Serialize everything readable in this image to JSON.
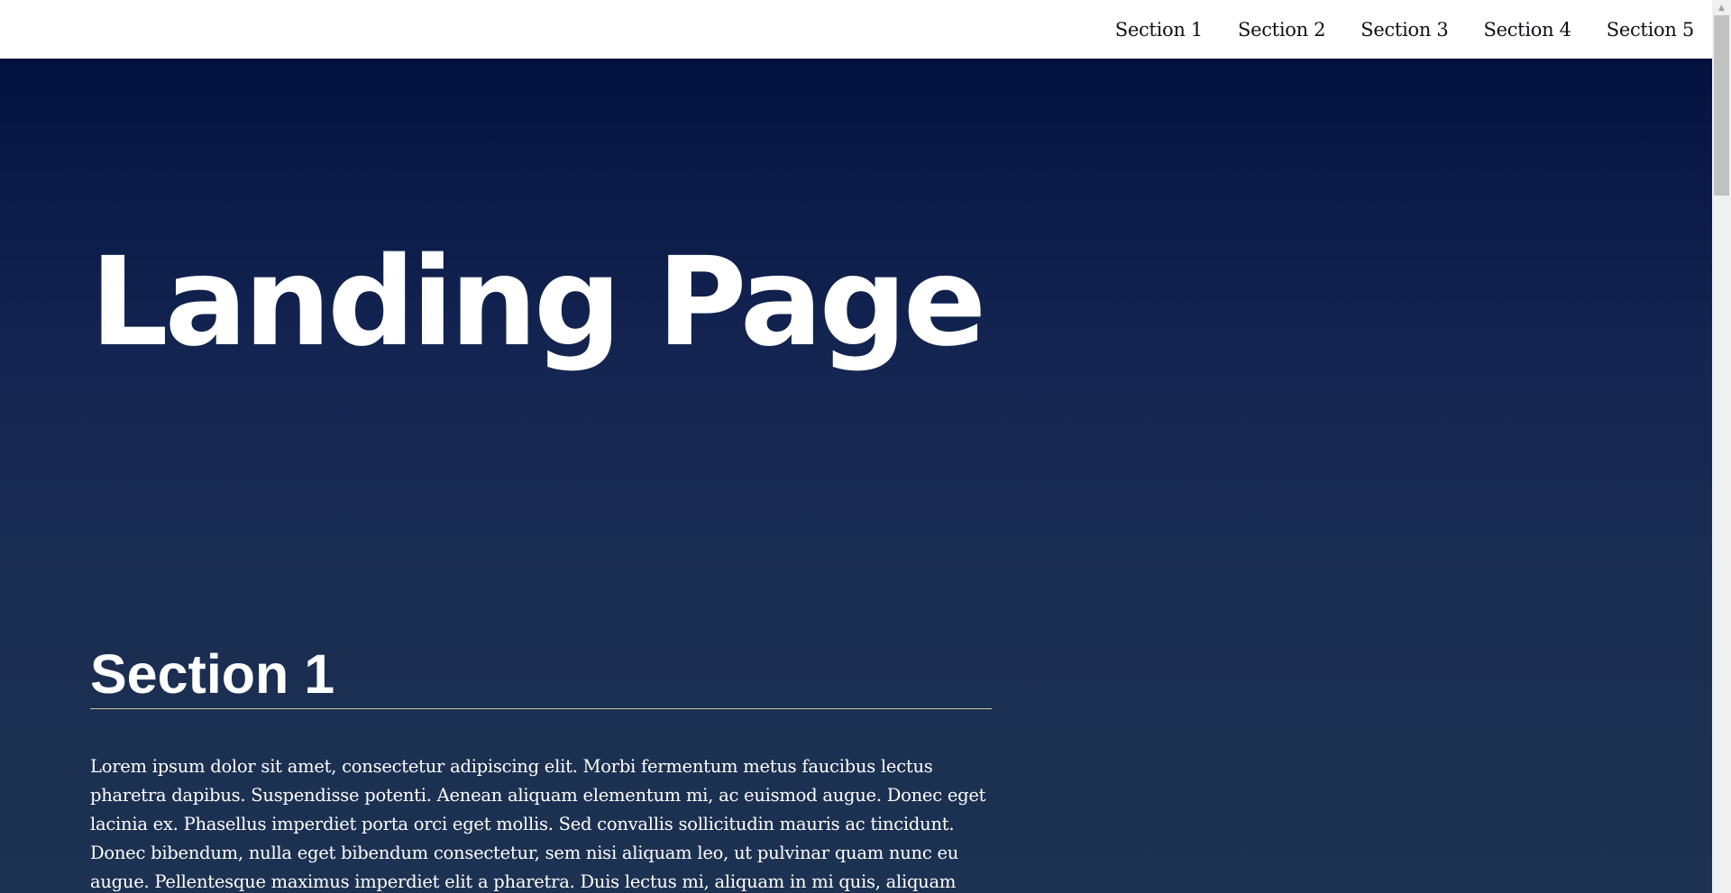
{
  "nav": {
    "items": [
      {
        "label": "Section 1"
      },
      {
        "label": "Section 2"
      },
      {
        "label": "Section 3"
      },
      {
        "label": "Section 4"
      },
      {
        "label": "Section 5"
      }
    ]
  },
  "hero": {
    "title": "Landing Page"
  },
  "section1": {
    "title": "Section 1",
    "body": "Lorem ipsum dolor sit amet, consectetur adipiscing elit. Morbi fermentum metus faucibus lectus pharetra dapibus. Suspendisse potenti. Aenean aliquam elementum mi, ac euismod augue. Donec eget lacinia ex. Phasellus imperdiet porta orci eget mollis. Sed convallis sollicitudin mauris ac tincidunt. Donec bibendum, nulla eget bibendum consectetur, sem nisi aliquam leo, ut pulvinar quam nunc eu augue. Pellentesque maximus imperdiet elit a pharetra. Duis lectus mi, aliquam in mi quis, aliquam"
  },
  "colors": {
    "nav_background": "#ffffff",
    "gradient_top": "#000d3c",
    "gradient_bottom": "#1d3252",
    "heading_rule": "#cccc99",
    "text": "#ffffff"
  }
}
